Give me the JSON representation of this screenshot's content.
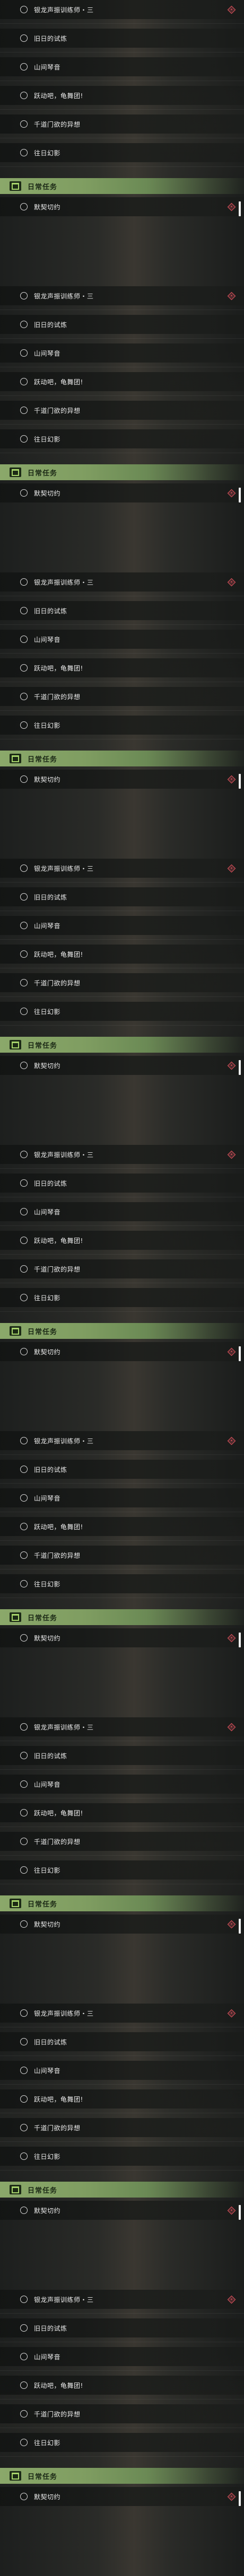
{
  "quest_list": {
    "repeats": 9,
    "quests": [
      {
        "label": "银龙声振训练师・三",
        "marker": true
      },
      {
        "label": "旧日的试炼",
        "marker": false
      },
      {
        "label": "山间琴音",
        "marker": false
      },
      {
        "label": "跃动吧，龟舞团!",
        "marker": false
      },
      {
        "label": "千道门欲的异想",
        "marker": false
      },
      {
        "label": "往日幻影",
        "marker": false
      }
    ],
    "daily": {
      "title": "日常任务",
      "note": "",
      "quest_label": "默契切约"
    }
  },
  "colors": {
    "accent_green": "#8ba86a",
    "marker_red": "#e0535e",
    "text": "#ececec"
  },
  "icons": {
    "radio": "radio-circle-icon",
    "marker": "red-diamond-marker-icon",
    "daily": "daily-task-icon"
  }
}
